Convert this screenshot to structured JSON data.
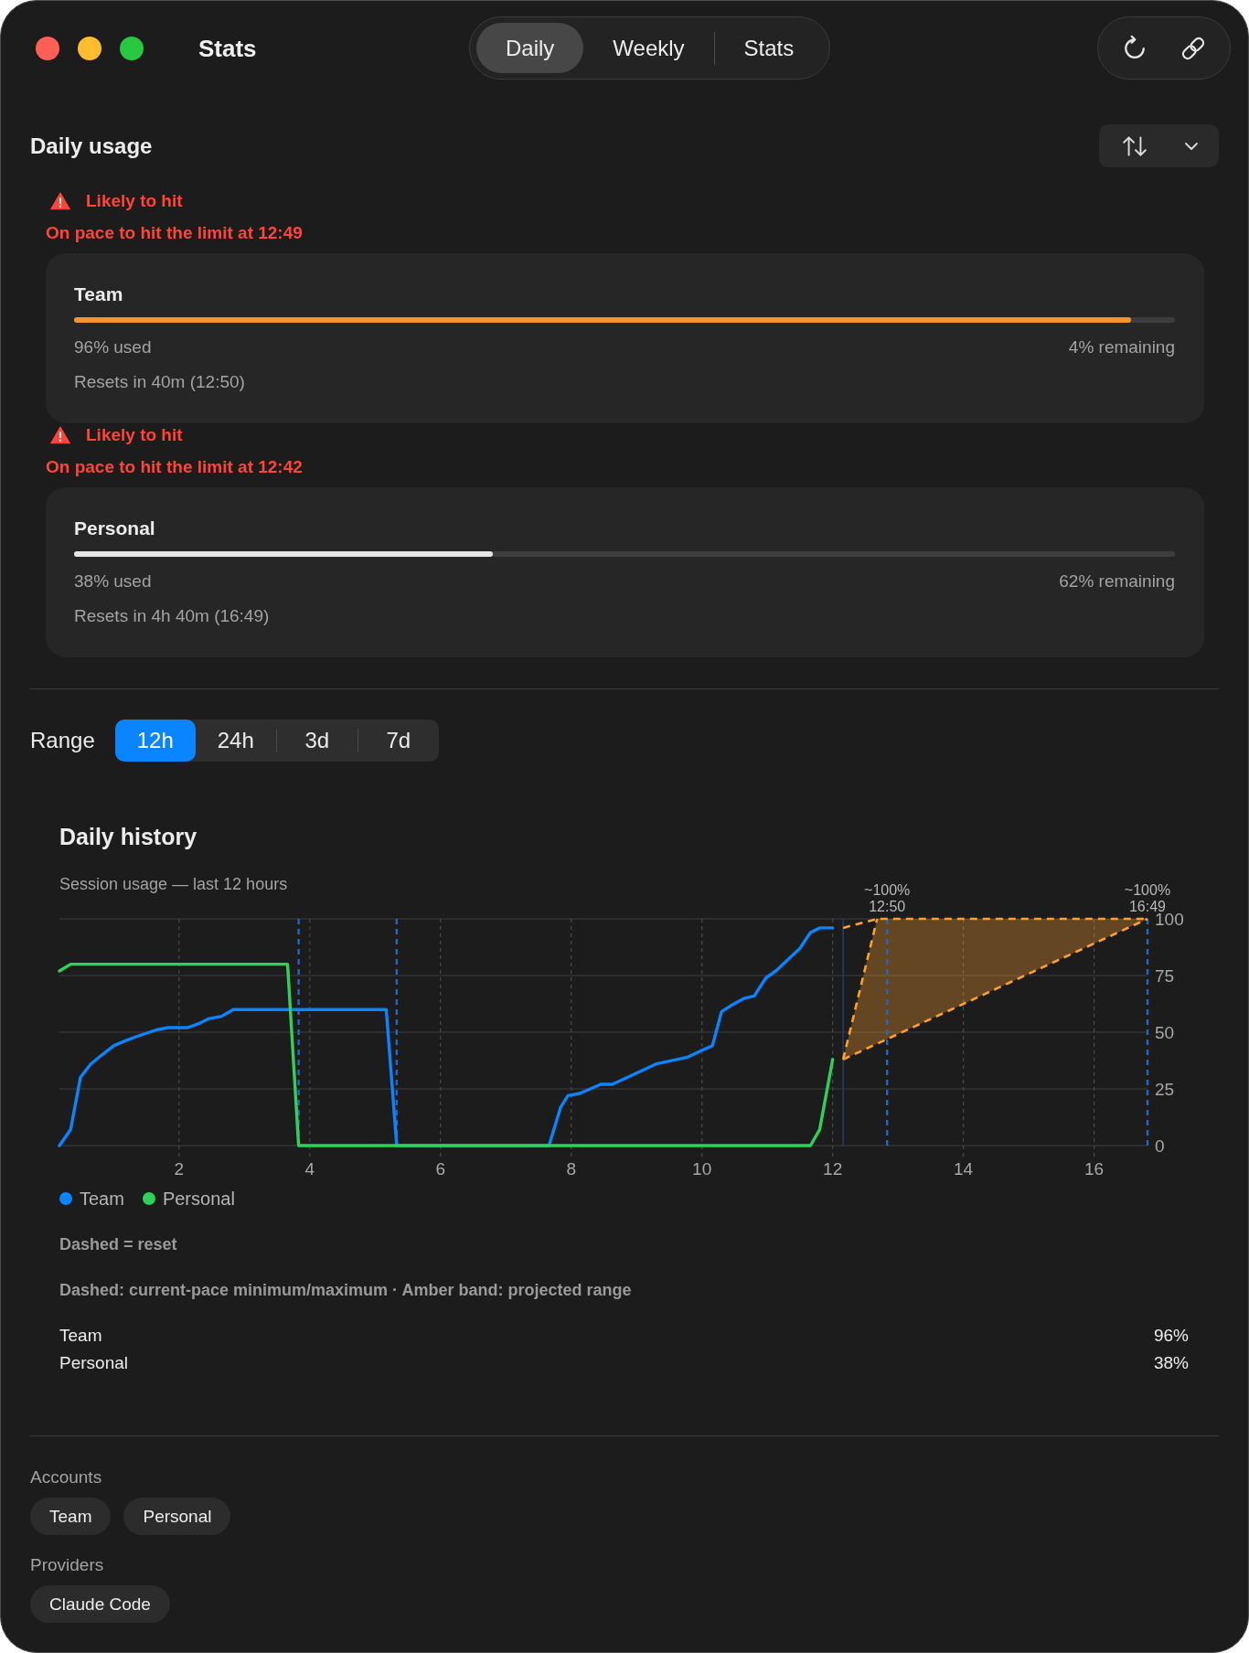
{
  "window": {
    "title": "Stats"
  },
  "tabs": [
    {
      "label": "Daily",
      "selected": true
    },
    {
      "label": "Weekly",
      "selected": false
    },
    {
      "label": "Stats",
      "selected": false
    }
  ],
  "usage": {
    "title": "Daily usage",
    "accounts": [
      {
        "alert": {
          "title": "Likely to hit",
          "message": "On pace to hit the limit at 12:49"
        },
        "name": "Team",
        "level": 0.96,
        "color": "#f7932f",
        "used": "96% used",
        "remaining": "4% remaining",
        "resets": "Resets in 40m (12:50)"
      },
      {
        "alert": {
          "title": "Likely to hit",
          "message": "On pace to hit the limit at 12:42"
        },
        "name": "Personal",
        "level": 0.38,
        "color": "#e6e6e6",
        "used": "38% used",
        "remaining": "62% remaining",
        "resets": "Resets in 4h 40m (16:49)"
      }
    ]
  },
  "range": {
    "label": "Range",
    "options": [
      {
        "label": "12h",
        "selected": true
      },
      {
        "label": "24h",
        "selected": false
      },
      {
        "label": "3d",
        "selected": false
      },
      {
        "label": "7d",
        "selected": false
      }
    ]
  },
  "history": {
    "title": "Daily history",
    "subtitle": "Session usage — last 12 hours",
    "chart_data": {
      "type": "line",
      "grid": true,
      "x": [
        0.17,
        0.34,
        0.49,
        0.65,
        0.82,
        1.0,
        1.16,
        1.34,
        1.65,
        1.83,
        2.13,
        2.32,
        2.46,
        2.65,
        2.83,
        3.66,
        3.83,
        5.17,
        5.33,
        7.66,
        7.84,
        7.95,
        8.13,
        8.29,
        8.45,
        8.63,
        9.3,
        9.78,
        10.0,
        10.16,
        10.3,
        10.46,
        10.65,
        10.8,
        10.98,
        11.13,
        11.5,
        11.66,
        11.8,
        12.0,
        12.16,
        12.68,
        16.817
      ],
      "series": [
        {
          "name": "Team",
          "line_style": "solid",
          "color": "#0a84ff",
          "values": [
            0,
            7,
            30,
            36,
            40,
            44,
            46,
            48,
            51,
            52,
            52,
            54,
            56,
            57,
            60,
            60,
            60,
            60,
            0,
            0,
            17,
            22,
            23,
            25,
            27,
            27,
            36,
            39,
            42,
            44,
            59,
            62,
            65,
            66,
            74,
            77,
            87,
            94,
            96,
            96,
            null,
            null,
            null
          ]
        },
        {
          "name": "Personal",
          "line_style": "solid",
          "color": "#30d158",
          "values": [
            77,
            80,
            80,
            80,
            80,
            80,
            80,
            80,
            80,
            80,
            80,
            80,
            80,
            80,
            80,
            80,
            0,
            0,
            0,
            0,
            0,
            0,
            0,
            0,
            0,
            0,
            0,
            0,
            0,
            0,
            0,
            0,
            0,
            0,
            0,
            0,
            0,
            0,
            7,
            38,
            null,
            null,
            null
          ]
        },
        {
          "line_style": "dashed",
          "color": "#ff9f2e",
          "values": [
            null,
            null,
            null,
            null,
            null,
            null,
            null,
            null,
            null,
            null,
            null,
            null,
            null,
            null,
            null,
            null,
            null,
            null,
            null,
            null,
            null,
            null,
            null,
            null,
            null,
            null,
            null,
            null,
            null,
            null,
            null,
            null,
            null,
            null,
            null,
            null,
            null,
            null,
            null,
            null,
            96,
            100,
            100
          ]
        },
        {
          "line_style": "dashed",
          "color": "#ff9f2e",
          "values": [
            null,
            null,
            null,
            null,
            null,
            null,
            null,
            null,
            null,
            null,
            null,
            null,
            null,
            null,
            null,
            null,
            null,
            null,
            null,
            null,
            null,
            null,
            null,
            null,
            null,
            null,
            null,
            null,
            null,
            null,
            null,
            null,
            null,
            null,
            null,
            null,
            null,
            null,
            null,
            null,
            38,
            100,
            null
          ]
        },
        {
          "line_style": "dashed",
          "color": "#ff9f2e",
          "values": [
            null,
            null,
            null,
            null,
            null,
            null,
            null,
            null,
            null,
            null,
            null,
            null,
            null,
            null,
            null,
            null,
            null,
            null,
            null,
            null,
            null,
            null,
            null,
            null,
            null,
            null,
            null,
            null,
            null,
            null,
            null,
            null,
            null,
            null,
            null,
            null,
            null,
            null,
            null,
            null,
            38,
            44.9,
            100
          ]
        }
      ],
      "ref_lines": [
        {
          "axis": "x",
          "value": 3.83,
          "color": "#2566c4",
          "line_style": "dashed"
        },
        {
          "axis": "x",
          "value": 5.33,
          "color": "#2566c4",
          "line_style": "dashed"
        },
        {
          "axis": "x",
          "value": 12.16,
          "color": "#1f3c66",
          "line_style": "solid"
        },
        {
          "axis": "x",
          "value": 12.833,
          "color": "#2566c4",
          "line_style": "dashed"
        },
        {
          "axis": "x",
          "value": 16.817,
          "color": "#2566c4",
          "line_style": "dashed"
        }
      ],
      "annotations": [
        {
          "text": "~100%",
          "x": 12.833,
          "y": 100
        },
        "12:50",
        {
          "text": "~100%",
          "x": 16.817,
          "y": 100
        },
        "16:49"
      ],
      "xlim": [
        0.17,
        16.817
      ],
      "ylim": [
        0,
        100
      ],
      "xticks": [
        2,
        4,
        6,
        8,
        10,
        12,
        14,
        16
      ],
      "yticks": [
        0,
        25,
        50,
        75,
        100
      ]
    },
    "notes": [
      "Dashed = reset",
      "Dashed: current-pace minimum/maximum · Amber band: projected range"
    ],
    "summary": [
      {
        "name": "Team",
        "value": "96%"
      },
      {
        "name": "Personal",
        "value": "38%"
      }
    ]
  },
  "filters": [
    {
      "label": "Accounts",
      "chips": [
        "Team",
        "Personal"
      ]
    },
    {
      "label": "Providers",
      "chips": [
        "Claude Code"
      ]
    }
  ]
}
